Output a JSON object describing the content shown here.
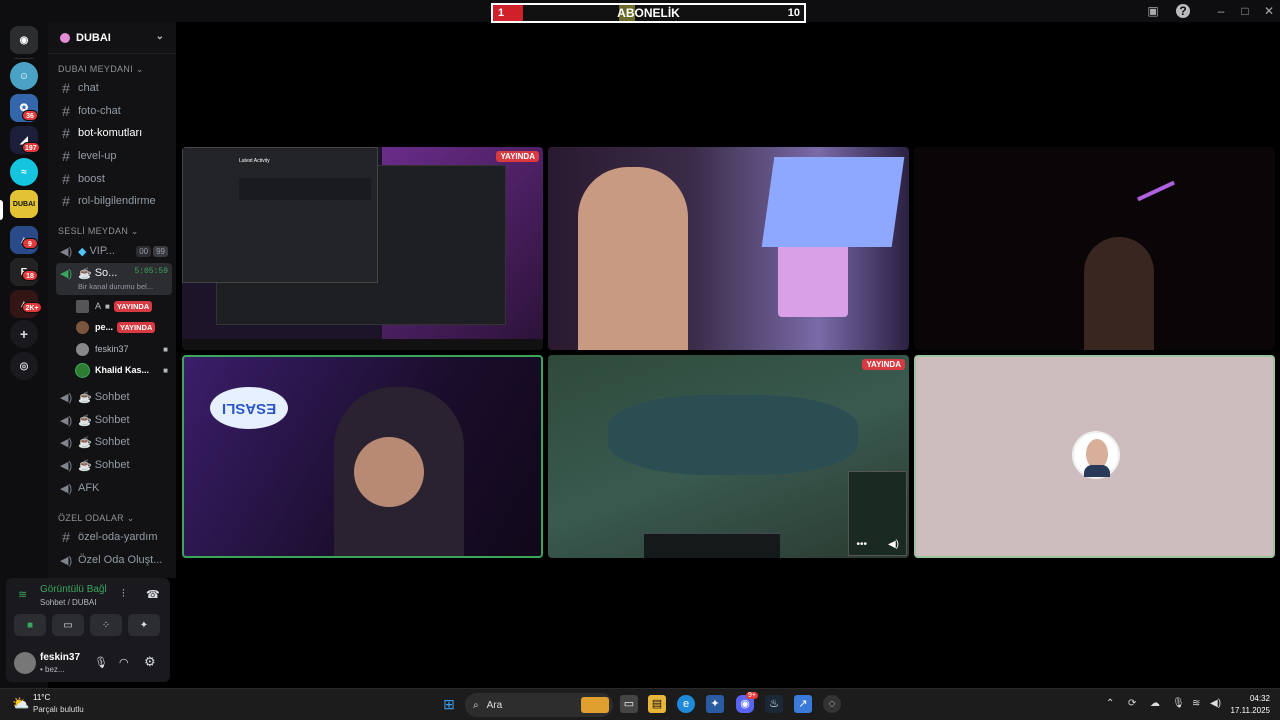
{
  "subscriber_bar": {
    "left_count": "1",
    "title": "ABONELİK",
    "right_count": "10"
  },
  "server": {
    "name": "DUBAI"
  },
  "rail_badges": [
    "36",
    "197",
    "9",
    "18",
    "2K+"
  ],
  "categories": {
    "text": "DUBAI MEYDANI",
    "voice": "SESLİ MEYDAN",
    "private": "ÖZEL ODALAR"
  },
  "text_channels": [
    "chat",
    "foto-chat",
    "bot-komutları",
    "level-up",
    "boost",
    "rol-bilgilendirme"
  ],
  "voice_channels": {
    "vip": {
      "label": "VIP...",
      "count_a": "00",
      "count_b": "99"
    },
    "sohbet_active": {
      "label": "So...",
      "timer": "5:05:59",
      "status": "Bir kanal durumu bel..."
    },
    "users": [
      {
        "name": "A",
        "live": "YAYINDA"
      },
      {
        "name": "pe...",
        "live": "YAYINDA"
      },
      {
        "name": "feskin37"
      },
      {
        "name": "Khalid Kas..."
      }
    ],
    "others": [
      "Sohbet",
      "Sohbet",
      "Sohbet",
      "Sohbet",
      "AFK"
    ]
  },
  "private_channels": [
    "özel-oda-yardım",
    "Özel Oda Oluşt..."
  ],
  "voice_panel": {
    "status": "Görüntülü Bağl",
    "location": "Sohbet / DUBAI",
    "username": "feskin37",
    "user_status": "• bez..."
  },
  "stage": {
    "live_label": "YAYINDA",
    "mini_window_title": "Latest Activity",
    "neon_sign": "ESASLI"
  },
  "taskbar": {
    "temp": "11°C",
    "weather": "Parçalı bulutlu",
    "search_placeholder": "Ara",
    "time": "04:32",
    "date": "17.11.2025",
    "discord_badge": "9+"
  },
  "colors": {
    "accent_green": "#3ba55c",
    "live_red": "#d83a42",
    "bar_red": "#d0202a"
  }
}
